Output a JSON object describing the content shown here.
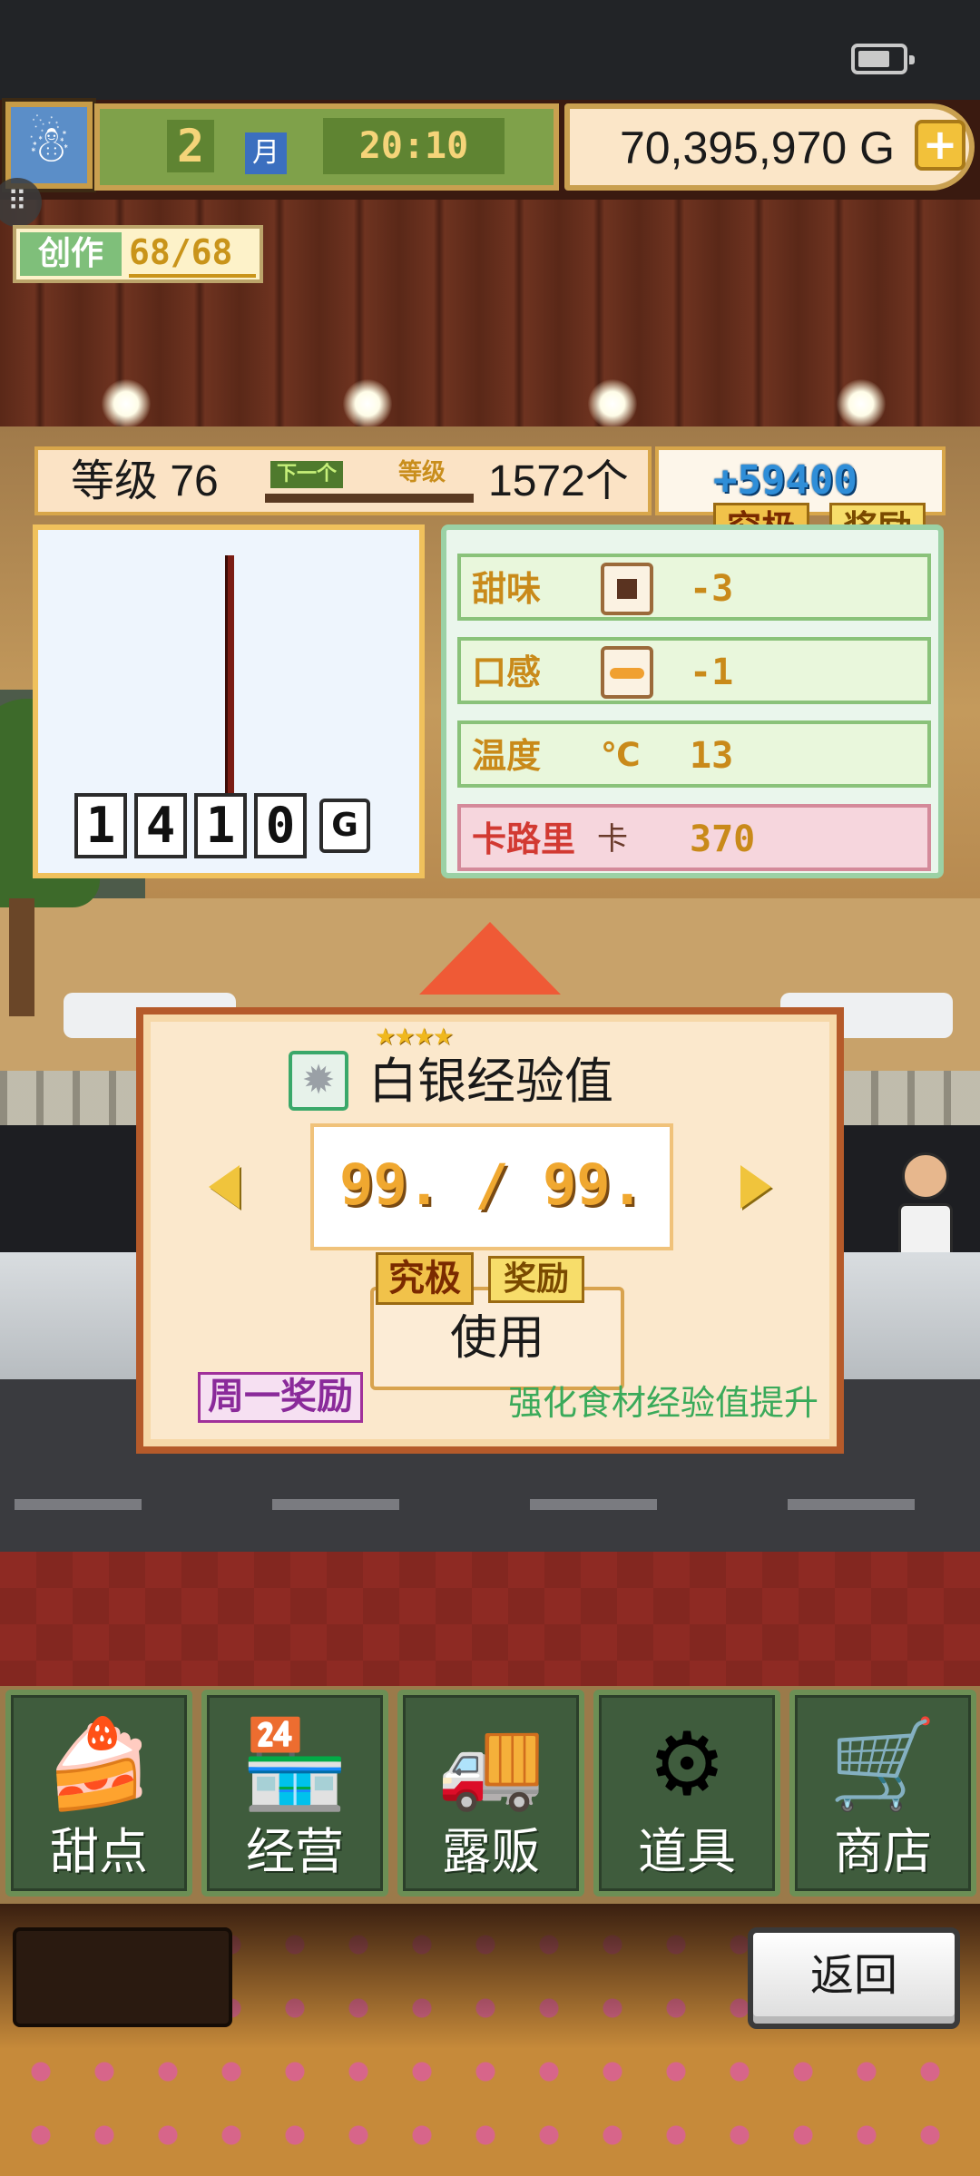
{
  "hud": {
    "month_number": "2",
    "month_label": "月",
    "time": "20:10",
    "money": "70,395,970",
    "money_unit": "G",
    "create_label": "创作",
    "create_value": "68/68"
  },
  "level": {
    "label": "等级 76",
    "next_tag": "下一个",
    "grade_tag": "等级",
    "count": "1572个",
    "bonus": "+59400",
    "ultimate_tag": "究极",
    "reward_tag": "奖励"
  },
  "preview": {
    "price_digits": [
      "1",
      "4",
      "1",
      "0"
    ],
    "currency": "G"
  },
  "stats": [
    {
      "label": "甜味",
      "icon": "sweet-icon",
      "value": "-3"
    },
    {
      "label": "口感",
      "icon": "texture-icon",
      "value": "-1"
    },
    {
      "label": "温度",
      "icon": "celsius-icon",
      "unit": "℃",
      "value": "13"
    }
  ],
  "calories": {
    "label": "卡路里",
    "unit": "卡",
    "value": "370"
  },
  "popup": {
    "stars": "★★★★",
    "item_name": "白银经验值",
    "count": "99. / 99.",
    "ultimate_tag": "究极",
    "reward_tag": "奖励",
    "use_label": "使用",
    "monday_tag": "周一奖励",
    "description": "强化食材经验值提升"
  },
  "nav": [
    {
      "label": "甜点",
      "icon": "cake-icon"
    },
    {
      "label": "经营",
      "icon": "shop-icon"
    },
    {
      "label": "露贩",
      "icon": "food-truck-icon"
    },
    {
      "label": "道具",
      "icon": "items-bag-icon"
    },
    {
      "label": "商店",
      "icon": "shopping-cart-icon"
    }
  ],
  "footer": {
    "back_label": "返回"
  }
}
